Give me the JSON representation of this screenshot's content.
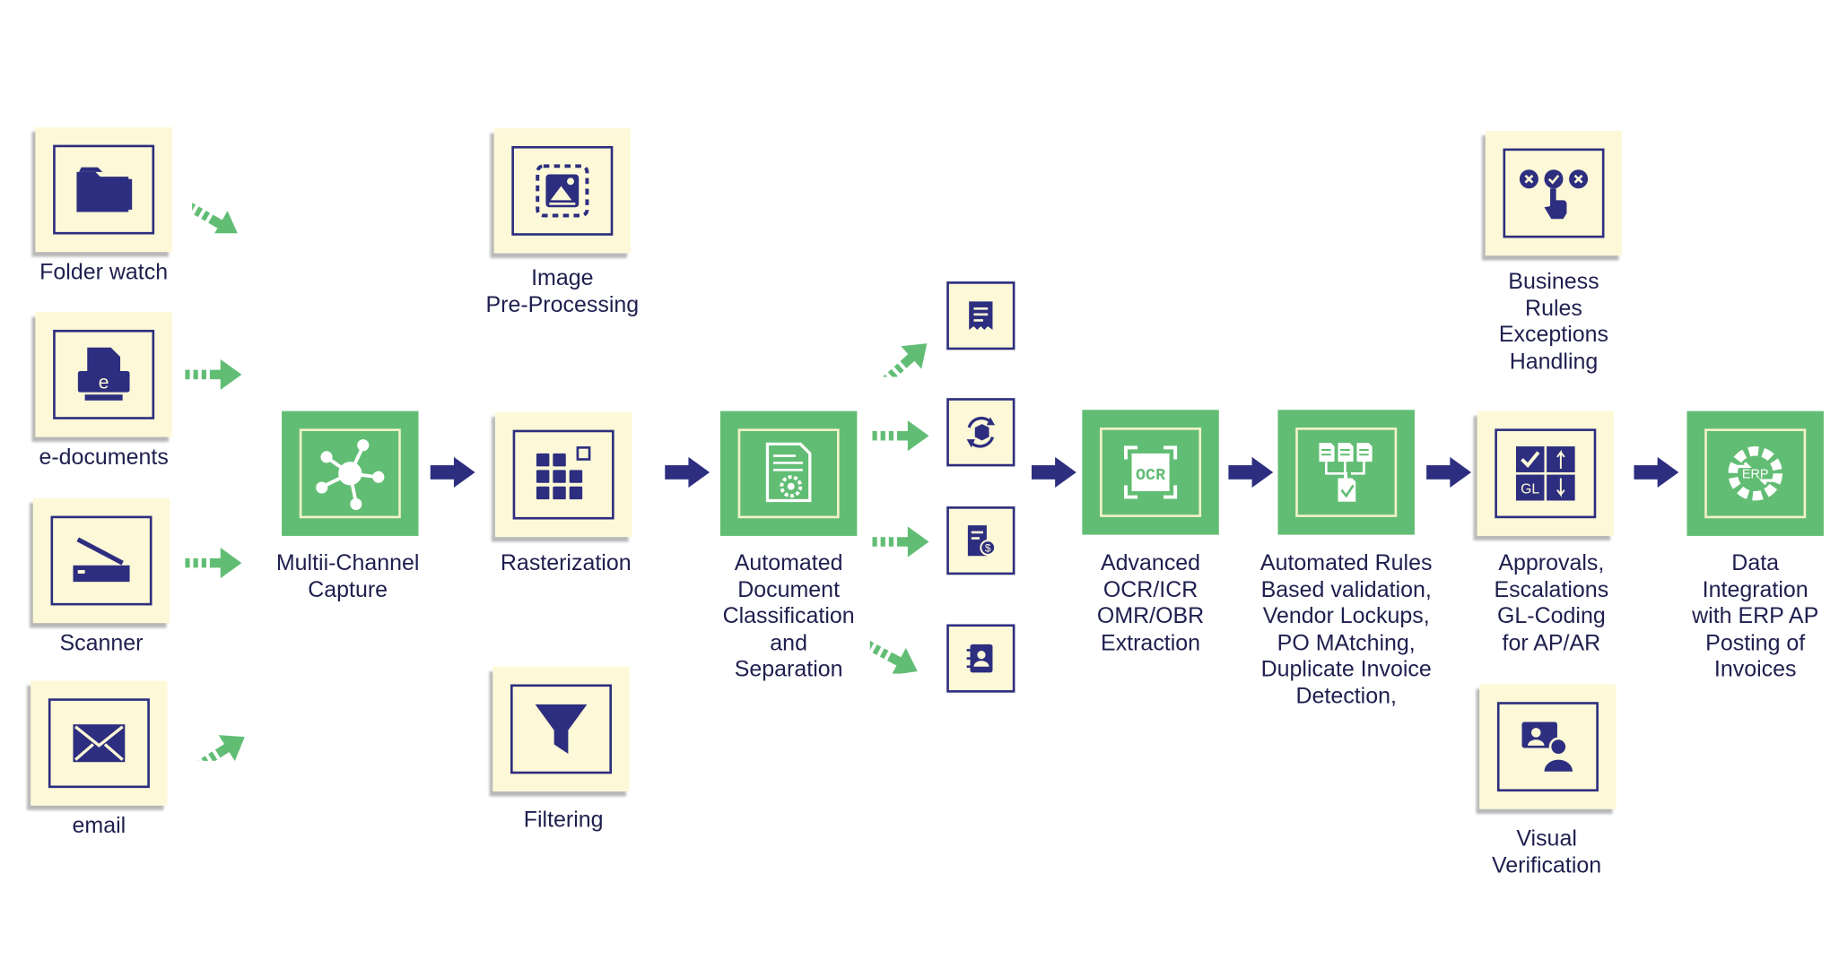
{
  "colors": {
    "cream": "#fdf9d8",
    "green": "#62bd74",
    "navy": "#2d2e7f",
    "text": "#1f1f4f"
  },
  "nodes": {
    "folder_watch": {
      "label": "Folder watch",
      "icon": "folder-icon"
    },
    "e_documents": {
      "label": "e-documents",
      "icon": "e-document-icon"
    },
    "scanner": {
      "label": "Scanner",
      "icon": "scanner-icon"
    },
    "email": {
      "label": "email",
      "icon": "envelope-icon"
    },
    "multi_channel": {
      "label": "Multii-Channel\nCapture",
      "icon": "network-hub-icon"
    },
    "image_pre": {
      "label": "Image\nPre-Processing",
      "icon": "image-icon"
    },
    "rasterization": {
      "label": "Rasterization",
      "icon": "grid-icon"
    },
    "filtering": {
      "label": "Filtering",
      "icon": "funnel-icon"
    },
    "classification": {
      "label": "Automated\nDocument\nClassification\nand\nSeparation",
      "icon": "document-gear-icon"
    },
    "ocr": {
      "label": "Advanced\nOCR/ICR\nOMR/OBR\nExtraction",
      "icon": "ocr-scan-icon",
      "icon_text": "OCR"
    },
    "rules": {
      "label": "Automated Rules\nBased validation,\nVendor Lockups,\nPO MAtching,\nDuplicate Invoice\nDetection,",
      "icon": "documents-check-icon"
    },
    "business_rules": {
      "label": "Business\nRules\nExceptions\nHandling",
      "icon": "hand-select-icon"
    },
    "approvals": {
      "label": "Approvals,\nEscalations\nGL-Coding\nfor AP/AR",
      "icon": "gl-coding-icon",
      "icon_text": "GL"
    },
    "visual": {
      "label": "Visual\nVerification",
      "icon": "user-screen-icon"
    },
    "erp": {
      "label": "Data\nIntegration\nwith ERP AP\nPosting of\nInvoices",
      "icon": "erp-gear-icon",
      "icon_text": "ERP"
    }
  },
  "doc_types": [
    "receipt-icon",
    "package-sync-icon",
    "invoice-dollar-icon",
    "contact-book-icon"
  ]
}
